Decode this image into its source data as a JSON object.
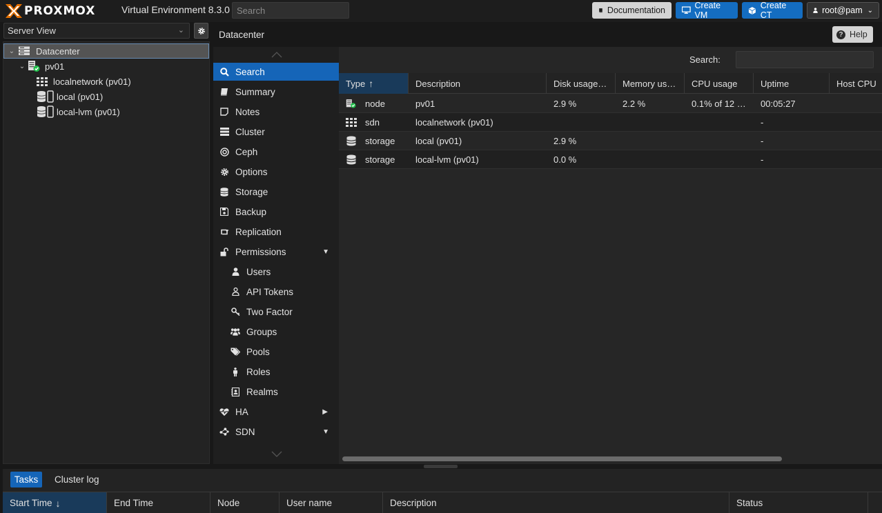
{
  "header": {
    "brand": "PROXMOX",
    "product": "Virtual Environment 8.3.0",
    "search_placeholder": "Search",
    "buttons": {
      "documentation": "Documentation",
      "create_vm": "Create VM",
      "create_ct": "Create CT",
      "user": "root@pam"
    }
  },
  "colors": {
    "accent": "#1565b8",
    "brand_orange": "#e57000",
    "status_green": "#21bf4b"
  },
  "tree": {
    "view_label": "Server View",
    "items": [
      {
        "label": "Datacenter",
        "icon": "datacenter-icon"
      },
      {
        "label": "pv01",
        "icon": "node-online-icon"
      },
      {
        "label": "localnetwork (pv01)",
        "icon": "sdn-grid-icon"
      },
      {
        "label": "local (pv01)",
        "icon": "storage-icon"
      },
      {
        "label": "local-lvm (pv01)",
        "icon": "storage-icon"
      }
    ]
  },
  "breadcrumb": "Datacenter",
  "help_label": "Help",
  "nav": [
    {
      "label": "Search",
      "icon": "search-icon"
    },
    {
      "label": "Summary",
      "icon": "book-icon"
    },
    {
      "label": "Notes",
      "icon": "note-icon"
    },
    {
      "label": "Cluster",
      "icon": "server-icon"
    },
    {
      "label": "Ceph",
      "icon": "ceph-icon"
    },
    {
      "label": "Options",
      "icon": "gear-icon"
    },
    {
      "label": "Storage",
      "icon": "database-icon"
    },
    {
      "label": "Backup",
      "icon": "floppy-icon"
    },
    {
      "label": "Replication",
      "icon": "retweet-icon"
    },
    {
      "label": "Permissions",
      "icon": "unlock-icon"
    },
    {
      "label": "Users",
      "icon": "user-icon"
    },
    {
      "label": "API Tokens",
      "icon": "user-outline-icon"
    },
    {
      "label": "Two Factor",
      "icon": "key-icon"
    },
    {
      "label": "Groups",
      "icon": "users-icon"
    },
    {
      "label": "Pools",
      "icon": "tags-icon"
    },
    {
      "label": "Roles",
      "icon": "male-icon"
    },
    {
      "label": "Realms",
      "icon": "address-book-icon"
    },
    {
      "label": "HA",
      "icon": "heartbeat-icon"
    },
    {
      "label": "SDN",
      "icon": "sdn-icon"
    }
  ],
  "content": {
    "search_label": "Search:",
    "columns": [
      "Type",
      "Description",
      "Disk usage…",
      "Memory us…",
      "CPU usage",
      "Uptime",
      "Host CPU"
    ],
    "rows": [
      {
        "type": "node",
        "description": "pv01",
        "disk": "2.9 %",
        "memory": "2.2 %",
        "cpu": "0.1% of 12 …",
        "uptime": "00:05:27",
        "host_cpu": "",
        "icon": "node-online-icon"
      },
      {
        "type": "sdn",
        "description": "localnetwork (pv01)",
        "disk": "",
        "memory": "",
        "cpu": "",
        "uptime": "-",
        "host_cpu": "",
        "icon": "sdn-grid-icon"
      },
      {
        "type": "storage",
        "description": "local (pv01)",
        "disk": "2.9 %",
        "memory": "",
        "cpu": "",
        "uptime": "-",
        "host_cpu": "",
        "icon": "database-icon"
      },
      {
        "type": "storage",
        "description": "local-lvm (pv01)",
        "disk": "0.0 %",
        "memory": "",
        "cpu": "",
        "uptime": "-",
        "host_cpu": "",
        "icon": "database-icon"
      }
    ]
  },
  "bottom": {
    "tabs": [
      "Tasks",
      "Cluster log"
    ],
    "columns": [
      "Start Time",
      "End Time",
      "Node",
      "User name",
      "Description",
      "Status"
    ]
  }
}
